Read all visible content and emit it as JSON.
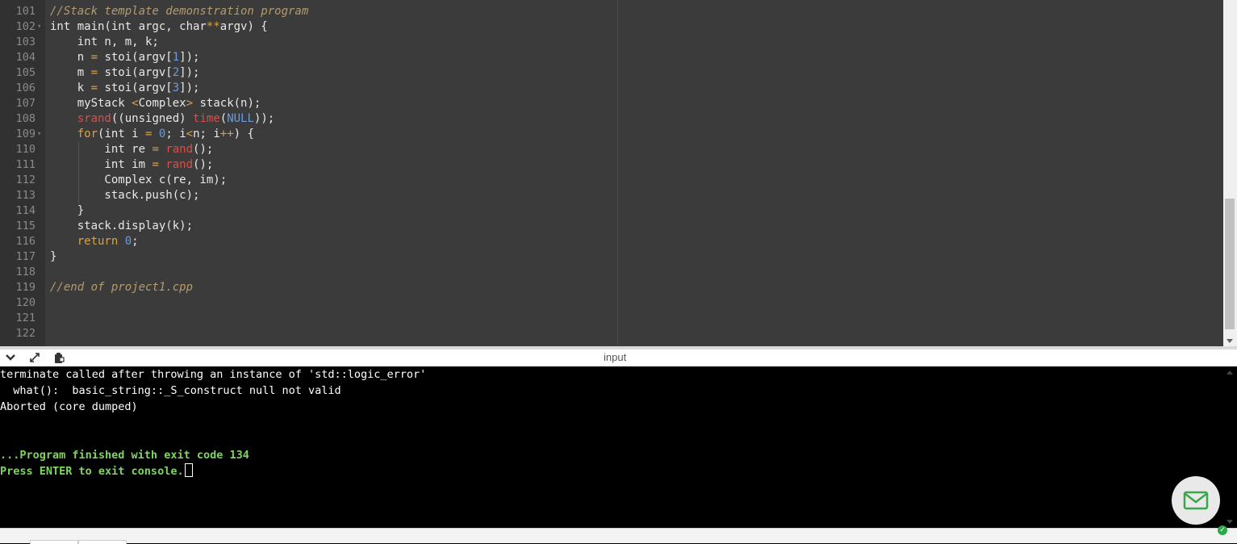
{
  "editor": {
    "lines": [
      {
        "n": "101",
        "fold": false,
        "tokens": [
          [
            "c",
            "//Stack template demonstration program"
          ]
        ]
      },
      {
        "n": "102",
        "fold": true,
        "tokens": [
          [
            "p",
            "int main(int argc, char"
          ],
          [
            "o",
            "**"
          ],
          [
            "p",
            "argv) {"
          ]
        ]
      },
      {
        "n": "103",
        "fold": false,
        "tokens": [
          [
            "p",
            "    int n, m, k;"
          ]
        ]
      },
      {
        "n": "104",
        "fold": false,
        "tokens": [
          [
            "p",
            "    n "
          ],
          [
            "o",
            "="
          ],
          [
            "p",
            " stoi(argv["
          ],
          [
            "d",
            "1"
          ],
          [
            "p",
            "]);"
          ]
        ]
      },
      {
        "n": "105",
        "fold": false,
        "tokens": [
          [
            "p",
            "    m "
          ],
          [
            "o",
            "="
          ],
          [
            "p",
            " stoi(argv["
          ],
          [
            "d",
            "2"
          ],
          [
            "p",
            "]);"
          ]
        ]
      },
      {
        "n": "106",
        "fold": false,
        "tokens": [
          [
            "p",
            "    k "
          ],
          [
            "o",
            "="
          ],
          [
            "p",
            " stoi(argv["
          ],
          [
            "d",
            "3"
          ],
          [
            "p",
            "]);"
          ]
        ]
      },
      {
        "n": "107",
        "fold": false,
        "tokens": [
          [
            "p",
            "    myStack "
          ],
          [
            "o",
            "<"
          ],
          [
            "p",
            "Complex"
          ],
          [
            "o",
            ">"
          ],
          [
            "p",
            " stack(n);"
          ]
        ]
      },
      {
        "n": "108",
        "fold": false,
        "tokens": [
          [
            "p",
            "    "
          ],
          [
            "f",
            "srand"
          ],
          [
            "p",
            "((unsigned) "
          ],
          [
            "f",
            "time"
          ],
          [
            "p",
            "("
          ],
          [
            "k2",
            "NULL"
          ],
          [
            "p",
            "));"
          ]
        ]
      },
      {
        "n": "109",
        "fold": true,
        "tokens": [
          [
            "p",
            "    "
          ],
          [
            "k",
            "for"
          ],
          [
            "p",
            "(int i "
          ],
          [
            "o",
            "="
          ],
          [
            "p",
            " "
          ],
          [
            "d",
            "0"
          ],
          [
            "p",
            "; i"
          ],
          [
            "o",
            "<"
          ],
          [
            "p",
            "n; i"
          ],
          [
            "o",
            "++"
          ],
          [
            "p",
            ") {"
          ]
        ]
      },
      {
        "n": "110",
        "fold": false,
        "tokens": [
          [
            "p",
            "        int re "
          ],
          [
            "o",
            "="
          ],
          [
            "p",
            " "
          ],
          [
            "f",
            "rand"
          ],
          [
            "p",
            "();"
          ]
        ]
      },
      {
        "n": "111",
        "fold": false,
        "tokens": [
          [
            "p",
            "        int im "
          ],
          [
            "o",
            "="
          ],
          [
            "p",
            " "
          ],
          [
            "f",
            "rand"
          ],
          [
            "p",
            "();"
          ]
        ]
      },
      {
        "n": "112",
        "fold": false,
        "tokens": [
          [
            "p",
            "        Complex c(re, im);"
          ]
        ]
      },
      {
        "n": "113",
        "fold": false,
        "tokens": [
          [
            "p",
            "        stack.push(c);"
          ]
        ]
      },
      {
        "n": "114",
        "fold": false,
        "tokens": [
          [
            "p",
            "    }"
          ]
        ]
      },
      {
        "n": "115",
        "fold": false,
        "tokens": [
          [
            "p",
            "    stack.display(k);"
          ]
        ]
      },
      {
        "n": "116",
        "fold": false,
        "tokens": [
          [
            "p",
            "    "
          ],
          [
            "k",
            "return"
          ],
          [
            "p",
            " "
          ],
          [
            "d",
            "0"
          ],
          [
            "p",
            ";"
          ]
        ]
      },
      {
        "n": "117",
        "fold": false,
        "tokens": [
          [
            "p",
            "}"
          ]
        ]
      },
      {
        "n": "118",
        "fold": false,
        "tokens": []
      },
      {
        "n": "119",
        "fold": false,
        "tokens": [
          [
            "c",
            "//end of project1.cpp"
          ]
        ]
      },
      {
        "n": "120",
        "fold": false,
        "tokens": []
      },
      {
        "n": "121",
        "fold": false,
        "tokens": []
      },
      {
        "n": "122",
        "fold": false,
        "tokens": []
      }
    ]
  },
  "console_bar": {
    "title": "input",
    "collapse_icon": "chevron-down-icon",
    "expand_icon": "expand-icon",
    "copy_icon": "clipboard-icon"
  },
  "console": {
    "lines": [
      {
        "text": "terminate called after throwing an instance of 'std::logic_error'",
        "style": "normal"
      },
      {
        "text": "  what():  basic_string::_S_construct null not valid",
        "style": "normal"
      },
      {
        "text": "Aborted (core dumped)",
        "style": "normal"
      },
      {
        "text": "",
        "style": "normal"
      },
      {
        "text": "",
        "style": "normal"
      },
      {
        "text": "...Program finished with exit code 134",
        "style": "green"
      },
      {
        "text": "Press ENTER to exit console.",
        "style": "green",
        "cursor": true
      }
    ]
  },
  "mail_button": {
    "icon": "mail-icon"
  },
  "status": {
    "icon": "check-icon"
  },
  "colors": {
    "editor_bg": "#3b3b3b",
    "gutter_bg": "#313131",
    "comment": "#b59b6b",
    "keyword": "#d6a34a",
    "function": "#d2524d",
    "number": "#6b9bd8",
    "console_bg": "#000000",
    "console_green": "#7dd65e",
    "status_green": "#2aa84a"
  }
}
